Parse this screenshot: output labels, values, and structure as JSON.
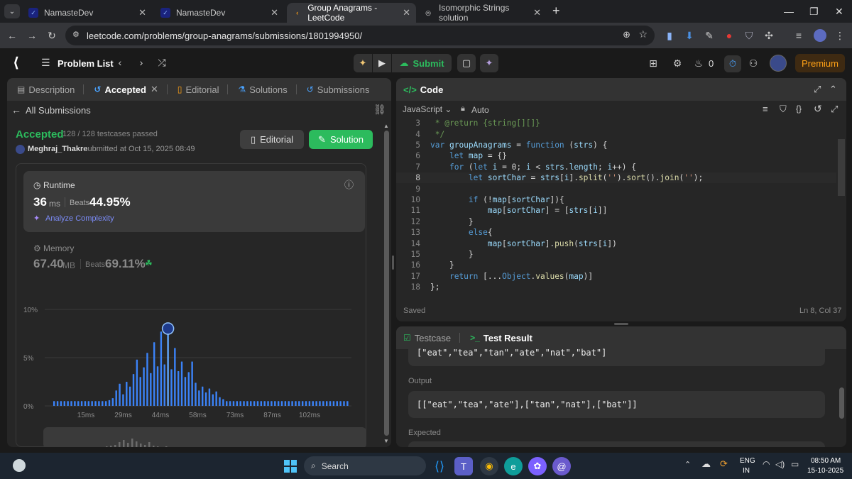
{
  "browser": {
    "tabs": [
      {
        "title": "NamasteDev",
        "fav": "N",
        "active": false
      },
      {
        "title": "NamasteDev",
        "fav": "N",
        "active": false
      },
      {
        "title": "Group Anagrams - LeetCode",
        "fav": "L",
        "active": true
      },
      {
        "title": "Isomorphic Strings solution",
        "fav": "◎",
        "active": false
      }
    ],
    "url": "leetcode.com/problems/group-anagrams/submissions/1801994950/"
  },
  "nav": {
    "problem_list": "Problem List",
    "submit": "Submit",
    "streak": "0",
    "premium": "Premium"
  },
  "left_tabs": {
    "description": "Description",
    "accepted": "Accepted",
    "editorial": "Editorial",
    "solutions": "Solutions",
    "submissions": "Submissions"
  },
  "submission": {
    "back": "All Submissions",
    "status": "Accepted",
    "testcases": "128 / 128 testcases passed",
    "user": "Meghraj_Thakre",
    "submitted": "submitted at Oct 15, 2025 08:49",
    "editorial_btn": "Editorial",
    "solution_btn": "Solution",
    "runtime_label": "Runtime",
    "runtime_value": "36",
    "runtime_unit": "ms",
    "beats_label": "Beats",
    "runtime_beats": "44.95%",
    "analyze": "Analyze Complexity",
    "memory_label": "Memory",
    "memory_value": "67.40",
    "memory_unit": "MB",
    "memory_beats": "69.11%"
  },
  "chart_data": {
    "type": "bar",
    "y_ticks": [
      "10%",
      "5%",
      "0%"
    ],
    "x_ticks": [
      "15ms",
      "29ms",
      "44ms",
      "58ms",
      "73ms",
      "87ms",
      "102ms"
    ],
    "ylim": [
      0,
      10
    ],
    "values": [
      0.5,
      0.5,
      0.5,
      0.5,
      0.5,
      0.5,
      0.5,
      0.5,
      0.5,
      0.5,
      0.5,
      0.5,
      0.5,
      0.5,
      0.5,
      0.5,
      0.6,
      0.8,
      1.6,
      2.3,
      1.2,
      2.5,
      2.0,
      3.3,
      4.8,
      3.0,
      4.0,
      5.5,
      3.4,
      6.6,
      4.1,
      7.7,
      4.3,
      8.6,
      3.8,
      6.0,
      3.6,
      4.6,
      3.0,
      3.5,
      4.6,
      2.4,
      1.6,
      2.0,
      1.4,
      1.8,
      1.2,
      1.5,
      0.9,
      0.7,
      0.5,
      0.5,
      0.5,
      0.5,
      0.5,
      0.5,
      0.5,
      0.5,
      0.5,
      0.5,
      0.5,
      0.5,
      0.5,
      0.5,
      0.5,
      0.5,
      0.5,
      0.5,
      0.5,
      0.5,
      0.5,
      0.5,
      0.5,
      0.5,
      0.5,
      0.5,
      0.5,
      0.5,
      0.5,
      0.5,
      0.5,
      0.5,
      0.5,
      0.5,
      0.5,
      0.5
    ],
    "highlight_index": 33
  },
  "code_panel": {
    "title": "Code",
    "language": "JavaScript",
    "mode": "Auto",
    "saved": "Saved",
    "cursor": "Ln 8, Col 37",
    "lines": [
      {
        "n": "3",
        "t": " * @return {string[][]}"
      },
      {
        "n": "4",
        "t": " */"
      },
      {
        "n": "5",
        "t": "var groupAnagrams = function (strs) {"
      },
      {
        "n": "6",
        "t": "    let map = {}"
      },
      {
        "n": "7",
        "t": "    for (let i = 0; i < strs.length; i++) {"
      },
      {
        "n": "8",
        "t": "        let sortChar = strs[i].split('').sort().join('');"
      },
      {
        "n": "9",
        "t": ""
      },
      {
        "n": "10",
        "t": "        if (!map[sortChar]){"
      },
      {
        "n": "11",
        "t": "            map[sortChar] = [strs[i]]"
      },
      {
        "n": "12",
        "t": "        }"
      },
      {
        "n": "13",
        "t": "        else{"
      },
      {
        "n": "14",
        "t": "            map[sortChar].push(strs[i])"
      },
      {
        "n": "15",
        "t": "        }"
      },
      {
        "n": "16",
        "t": "    }"
      },
      {
        "n": "17",
        "t": "    return [...Object.values(map)]"
      },
      {
        "n": "18",
        "t": "};"
      }
    ]
  },
  "result_panel": {
    "testcase_tab": "Testcase",
    "result_tab": "Test Result",
    "input_value": "[\"eat\",\"tea\",\"tan\",\"ate\",\"nat\",\"bat\"]",
    "output_label": "Output",
    "output_value": "[[\"eat\",\"tea\",\"ate\"],[\"tan\",\"nat\"],[\"bat\"]]",
    "expected_label": "Expected"
  },
  "taskbar": {
    "search": "Search",
    "lang1": "ENG",
    "lang2": "IN",
    "time": "08:50 AM",
    "date": "15-10-2025"
  },
  "colors": {
    "accepted": "#2cbb5d",
    "chart_bar": "#3b82f6",
    "premium_bg": "#3e2a12",
    "premium_text": "#ffa116"
  }
}
